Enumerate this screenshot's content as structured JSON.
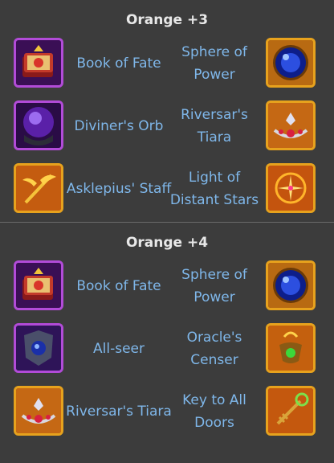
{
  "sections": [
    {
      "title": "Orange +3",
      "rows": [
        {
          "left": {
            "label": "Book of Fate",
            "icon": "book-icon",
            "frame": "purple"
          },
          "right": {
            "label": "Sphere of Power",
            "icon": "sphere-icon",
            "frame": "orange"
          }
        },
        {
          "left": {
            "label": "Diviner's Orb",
            "icon": "orb-icon",
            "frame": "purple"
          },
          "right": {
            "label": "Riversar's Tiara",
            "icon": "tiara-icon",
            "frame": "orange"
          }
        },
        {
          "left": {
            "label": "Asklepius' Staff",
            "icon": "staff-icon",
            "frame": "orange"
          },
          "right": {
            "label": "Light of Distant Stars",
            "icon": "star-light-icon",
            "frame": "orange"
          }
        }
      ]
    },
    {
      "title": "Orange +4",
      "rows": [
        {
          "left": {
            "label": "Book of Fate",
            "icon": "book-icon",
            "frame": "purple"
          },
          "right": {
            "label": "Sphere of Power",
            "icon": "sphere-icon",
            "frame": "orange"
          }
        },
        {
          "left": {
            "label": "All-seer",
            "icon": "all-seer-icon",
            "frame": "purple"
          },
          "right": {
            "label": "Oracle's Censer",
            "icon": "censer-icon",
            "frame": "orange"
          }
        },
        {
          "left": {
            "label": "Riversar's Tiara",
            "icon": "tiara-icon",
            "frame": "orange"
          },
          "right": {
            "label": "Key to All Doors",
            "icon": "key-icon",
            "frame": "orange"
          }
        }
      ]
    }
  ],
  "colors": {
    "background": "#3c3c3c",
    "label": "#7fb7ea",
    "title": "#e8e8e8",
    "frame_purple": "#b24bd8",
    "frame_orange": "#e7a21d"
  }
}
